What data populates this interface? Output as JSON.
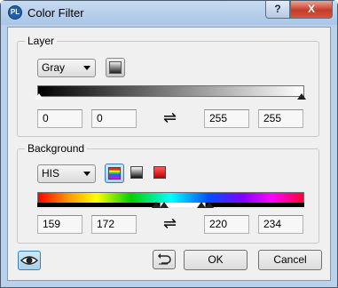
{
  "window": {
    "title": "Color Filter",
    "app_icon_text": "PL",
    "help_label": "?",
    "close_label": "X"
  },
  "layer": {
    "group_label": "Layer",
    "channel": "Gray",
    "range": {
      "min_a": "0",
      "min_b": "0",
      "max_a": "255",
      "max_b": "255"
    },
    "swap_symbol": "⇌"
  },
  "background": {
    "group_label": "Background",
    "mode": "HIS",
    "range": {
      "min_a": "159",
      "min_b": "172",
      "max_a": "220",
      "max_b": "234"
    },
    "swap_symbol": "⇌"
  },
  "buttons": {
    "ok": "OK",
    "cancel": "Cancel"
  },
  "colors": {
    "title_bar": "#b9d1ea",
    "close": "#c43b26",
    "active_tool": "#a8cfea"
  }
}
